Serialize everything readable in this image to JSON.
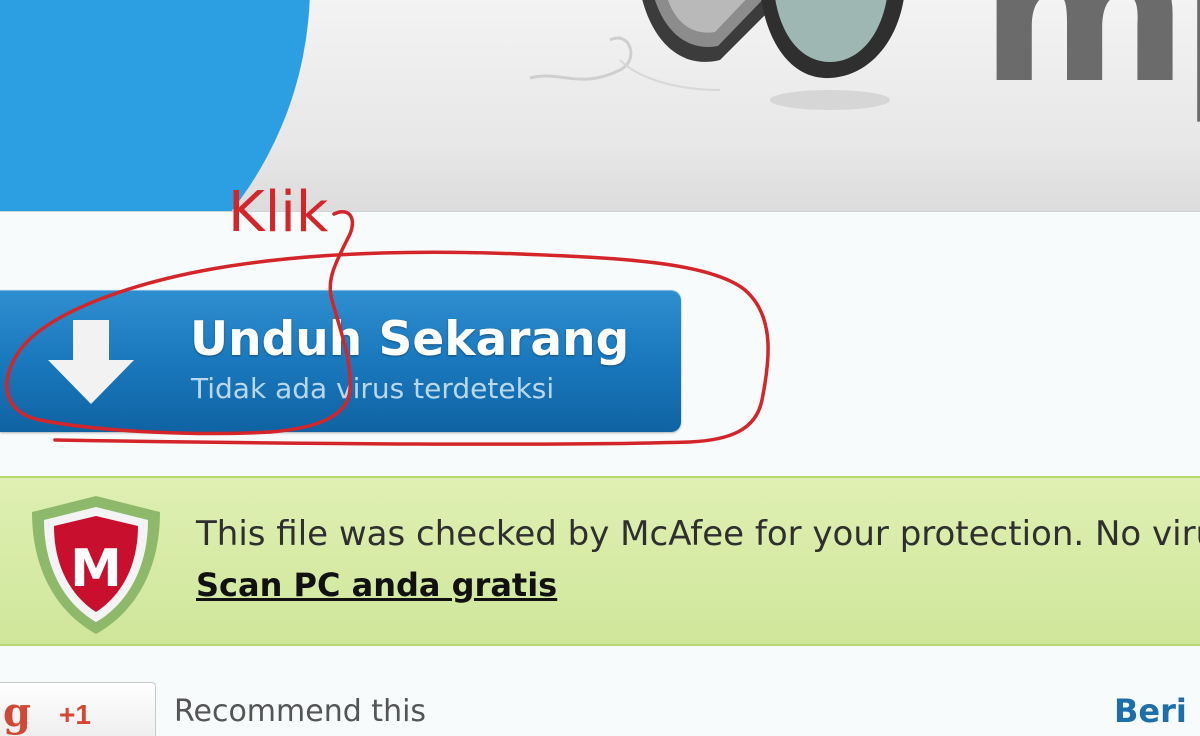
{
  "header": {
    "logo_text": "mp",
    "speaker_icon": "speaker-icon"
  },
  "download": {
    "title": "Unduh Sekarang",
    "subtitle": "Tidak ada virus terdeteksi",
    "icon": "download-arrow-icon",
    "color": "#1a78bd"
  },
  "mcafee": {
    "message": "This file was checked by McAfee for your protection. No viru",
    "scan_link": "Scan PC anda gratis",
    "logo_icon": "mcafee-shield-icon",
    "logo_letter": "M",
    "color": "#cfe69a"
  },
  "social": {
    "plusone_label": "+1",
    "gplus_letter": "g",
    "recommend_text": "Recommend this",
    "right_link": "Beri"
  },
  "annotation": {
    "label": "Klik",
    "color": "#d3252a"
  }
}
